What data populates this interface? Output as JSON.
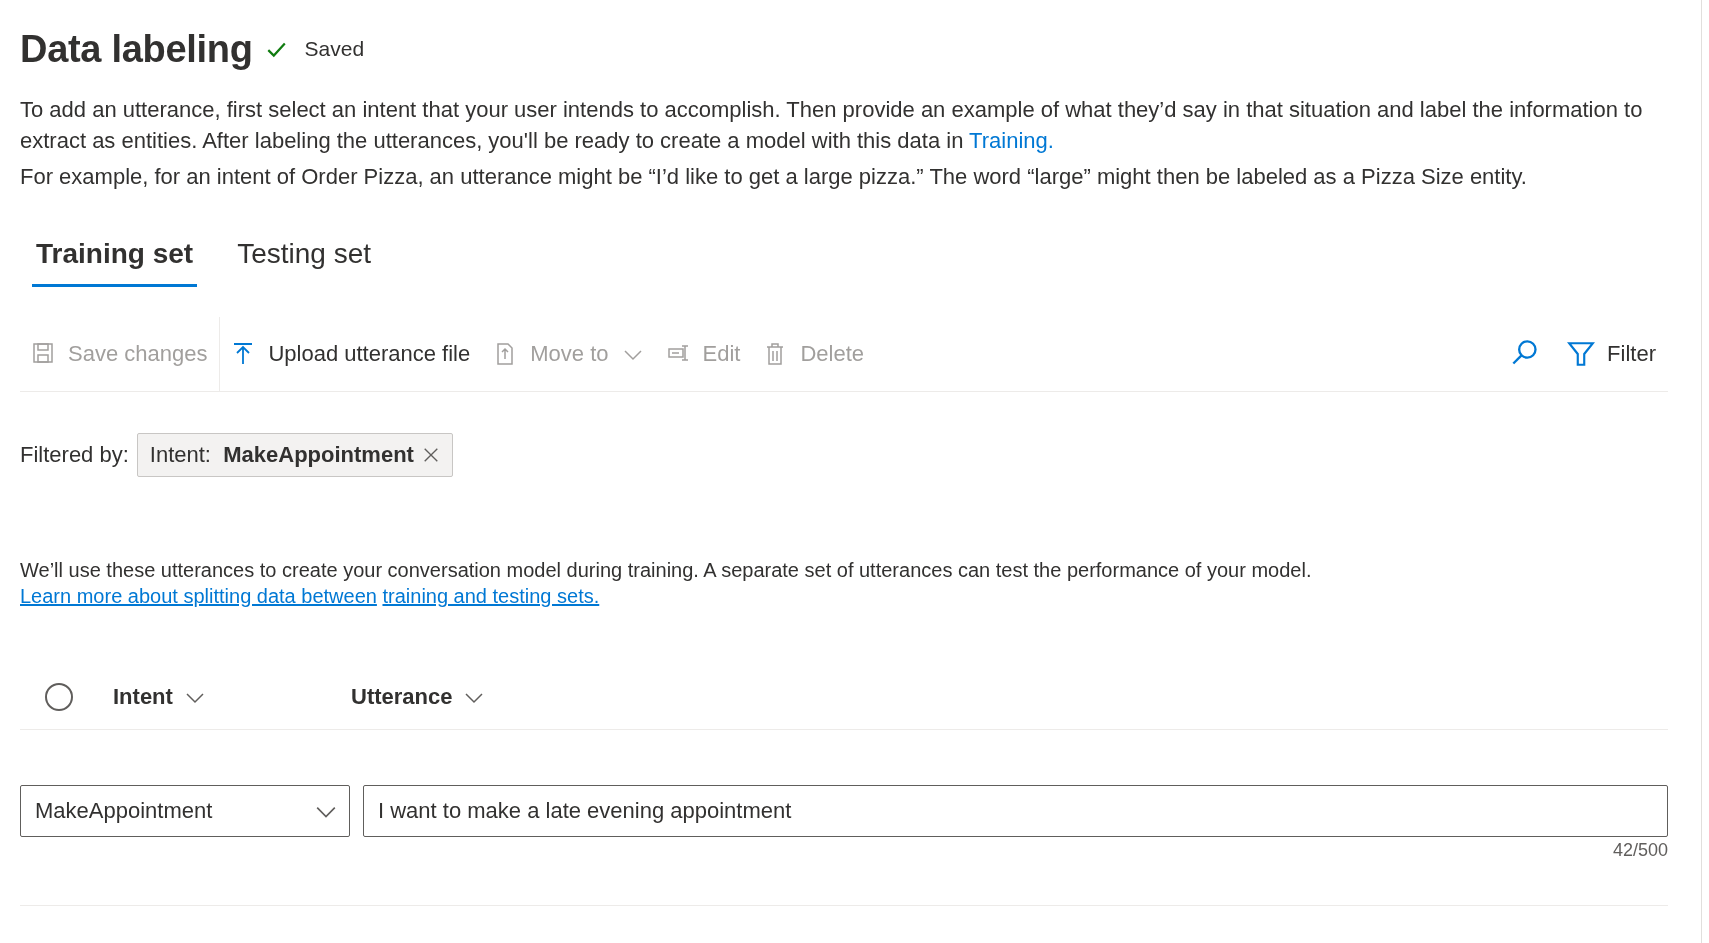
{
  "header": {
    "title": "Data labeling",
    "status": "Saved"
  },
  "intro": [
    "To add an utterance, first select an intent that your user intends to accomplish. Then provide an example of what they’d say in that situation and label the information to extract as entities. After labeling the utterances, you'll be ready to create a model with this data in ",
    "Training.",
    "For example, for an intent of Order Pizza, an utterance might be “I’d like to get a large pizza.” The word “large” might then be labeled as a Pizza Size entity."
  ],
  "tabs": [
    {
      "label": "Training set",
      "selected": true
    },
    {
      "label": "Testing set",
      "selected": false
    }
  ],
  "toolbar": [
    {
      "kind": "save",
      "label": "Save changes",
      "disabled": true
    },
    {
      "kind": "upload",
      "label": "Upload utterance file",
      "disabled": false
    },
    {
      "kind": "move",
      "label": "Move to",
      "disabled": true
    },
    {
      "kind": "edit",
      "label": "Edit",
      "disabled": true
    },
    {
      "kind": "delete",
      "label": "Delete",
      "disabled": true
    }
  ],
  "toolbar_right": {
    "filter_label": "Filter"
  },
  "filter": {
    "label": "Filtered by:",
    "key": "Intent:",
    "value": "MakeAppointment"
  },
  "note": {
    "text": "We’ll use these utterances to create your conversation model during training. A separate set of utterances can test the performance of your model. ",
    "link": [
      "Learn more about splitting data between",
      "training and testing sets."
    ]
  },
  "table": {
    "select_all": {
      "checked": false
    },
    "columns": [
      "Intent",
      "Utterance"
    ],
    "rows": [
      {
        "intent": "MakeAppointment",
        "utterance": "I want to make a late evening appointment",
        "counter": "42/500"
      }
    ]
  }
}
